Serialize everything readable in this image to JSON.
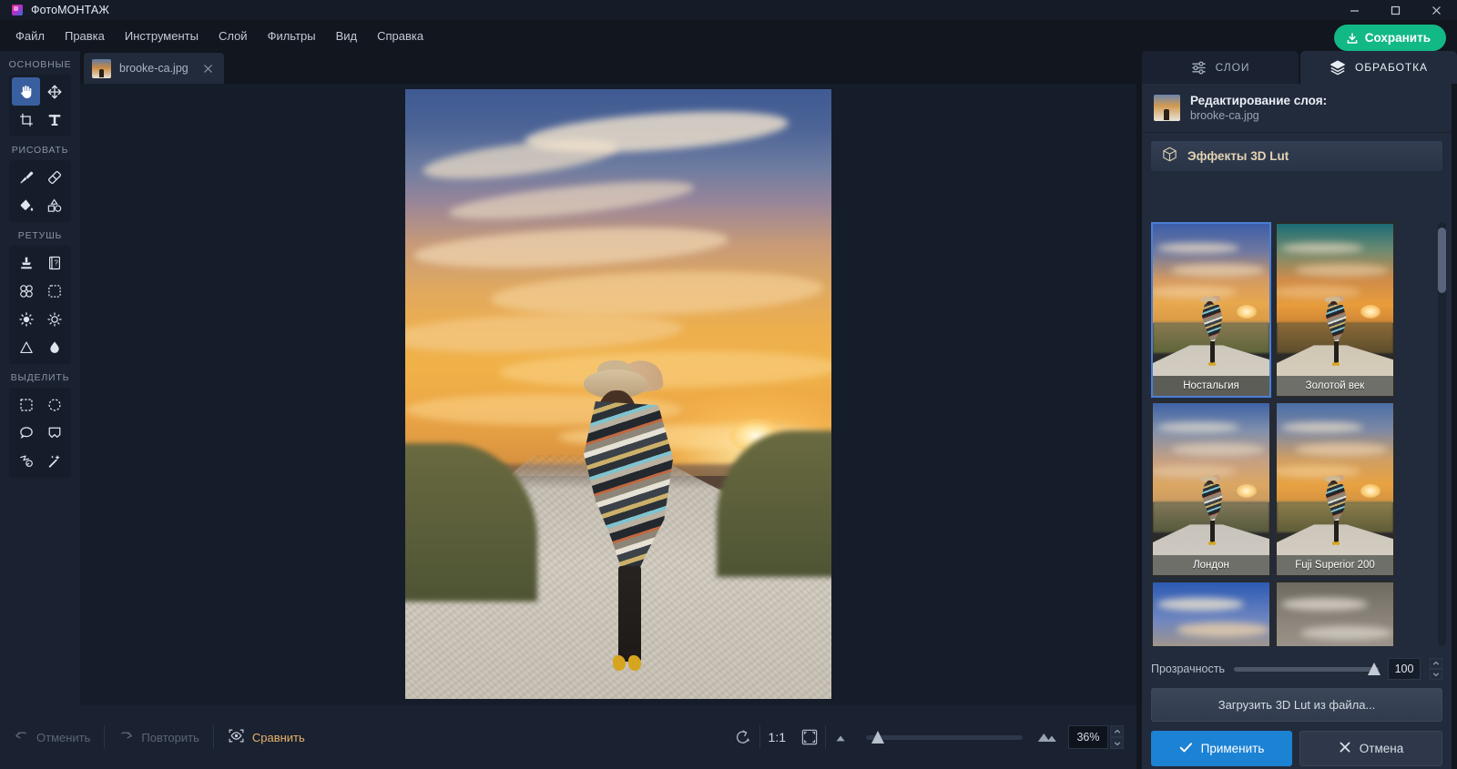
{
  "window": {
    "app_title": "ФотоМОНТАЖ",
    "logo_icon": "app-logo-icon",
    "minimize_icon": "minimize-icon",
    "maximize_icon": "maximize-icon",
    "close_icon": "close-icon"
  },
  "menubar": {
    "items": [
      {
        "label": "Файл"
      },
      {
        "label": "Правка"
      },
      {
        "label": "Инструменты"
      },
      {
        "label": "Слой"
      },
      {
        "label": "Фильтры"
      },
      {
        "label": "Вид"
      },
      {
        "label": "Справка"
      }
    ],
    "save_label": "Сохранить",
    "save_icon": "download-icon",
    "save_color": "#12b886"
  },
  "toolbar": {
    "groups": [
      {
        "label": "ОСНОВНЫЕ",
        "tools": [
          {
            "icon": "hand-icon",
            "active": true
          },
          {
            "icon": "move-icon",
            "active": false
          },
          {
            "icon": "crop-icon",
            "active": false
          },
          {
            "icon": "text-icon",
            "active": false
          }
        ]
      },
      {
        "label": "РИСОВАТЬ",
        "tools": [
          {
            "icon": "brush-icon",
            "active": false
          },
          {
            "icon": "eraser-icon",
            "active": false
          },
          {
            "icon": "paint-bucket-icon",
            "active": false
          },
          {
            "icon": "shapes-icon",
            "active": false
          }
        ]
      },
      {
        "label": "РЕТУШЬ",
        "tools": [
          {
            "icon": "clone-stamp-icon",
            "active": false
          },
          {
            "icon": "patch-icon",
            "active": false
          },
          {
            "icon": "blemish-remover-icon",
            "active": false
          },
          {
            "icon": "content-aware-icon",
            "active": false
          },
          {
            "icon": "dodge-icon",
            "active": false
          },
          {
            "icon": "burn-icon",
            "active": false
          },
          {
            "icon": "sharpen-icon",
            "active": false
          },
          {
            "icon": "blur-drop-icon",
            "active": false
          }
        ]
      },
      {
        "label": "ВЫДЕЛИТЬ",
        "tools": [
          {
            "icon": "rect-select-icon",
            "active": false
          },
          {
            "icon": "ellipse-select-icon",
            "active": false
          },
          {
            "icon": "lasso-icon",
            "active": false
          },
          {
            "icon": "polygon-lasso-icon",
            "active": false
          },
          {
            "icon": "magnetic-lasso-icon",
            "active": false
          },
          {
            "icon": "magic-wand-icon",
            "active": false
          }
        ]
      }
    ]
  },
  "document_tabs": [
    {
      "label": "brooke-ca.jpg",
      "active": true,
      "close_icon": "close-icon",
      "thumb_icon": "document-thumbnail"
    }
  ],
  "canvas": {
    "image_name": "brooke-ca.jpg",
    "description": "Женщина в полосатом пончо и шляпе стоит на гравийной дороге на фоне заката"
  },
  "statusbar": {
    "undo_label": "Отменить",
    "undo_icon": "undo-icon",
    "redo_label": "Повторить",
    "redo_icon": "redo-icon",
    "compare_label": "Сравнить",
    "compare_icon": "eye-compare-icon",
    "compare_highlight_color": "#e7b46a",
    "rotate_icon": "rotate-icon",
    "ratio_label": "1:1",
    "fit_icon": "fit-to-screen-icon",
    "zoom_out_icon": "zoom-out-mountain-icon",
    "zoom_in_icon": "zoom-in-mountain-icon",
    "zoom_value": "36%",
    "zoom_percent": 36,
    "spin_up_icon": "chevron-up-icon",
    "spin_down_icon": "chevron-down-icon"
  },
  "right_panel": {
    "tabs": [
      {
        "label": "СЛОИ",
        "icon": "sliders-icon",
        "active": false
      },
      {
        "label": "ОБРАБОТКА",
        "icon": "layers-stack-icon",
        "active": true
      }
    ],
    "layer_header": {
      "title": "Редактирование слоя:",
      "filename": "brooke-ca.jpg",
      "thumb_icon": "layer-thumbnail"
    },
    "section": {
      "title": "Эффекты 3D Lut",
      "icon": "cube-3d-icon",
      "title_color": "#e3d4b4"
    },
    "luts": [
      {
        "name": "Ностальгия",
        "selected": true,
        "sky_top": "#3c5ea8",
        "sky_mid": "#d39a62",
        "sky_bot": "#e8a84d",
        "field": "#6f6a45",
        "road": "#cdc7bc"
      },
      {
        "name": "Золотой век",
        "selected": false,
        "sky_top": "#1b6b74",
        "sky_mid": "#d28c4a",
        "sky_bot": "#e89c3a",
        "field": "#7a6338",
        "road": "#cfc6b4"
      },
      {
        "name": "Лондон",
        "selected": false,
        "sky_top": "#3e62a6",
        "sky_mid": "#c6a083",
        "sky_bot": "#dca763",
        "field": "#6c6a4c",
        "road": "#c7c3bb"
      },
      {
        "name": "Fuji Superior 200",
        "selected": false,
        "sky_top": "#4a6ea6",
        "sky_mid": "#d09f63",
        "sky_bot": "#e8a242",
        "field": "#7d7147",
        "road": "#ccc5b9"
      },
      {
        "name": "",
        "selected": false,
        "sky_top": "#2b5ab4",
        "sky_mid": "#d9a84f",
        "sky_bot": "#f0bb3f",
        "field": "#7e6e3c",
        "road": "#cbc4b5"
      },
      {
        "name": "",
        "selected": false,
        "sky_top": "#6e6a60",
        "sky_mid": "#9b948a",
        "sky_bot": "#b5ada1",
        "field": "#8b8478",
        "road": "#c4bdb2"
      }
    ],
    "opacity": {
      "label": "Прозрачность",
      "value": "100",
      "percent": 100,
      "spin_up_icon": "chevron-up-icon",
      "spin_down_icon": "chevron-down-icon"
    },
    "load_lut_label": "Загрузить 3D Lut из файла...",
    "apply_label": "Применить",
    "apply_icon": "check-icon",
    "apply_color": "#1c82d4",
    "cancel_label": "Отмена",
    "cancel_icon": "cross-icon"
  }
}
